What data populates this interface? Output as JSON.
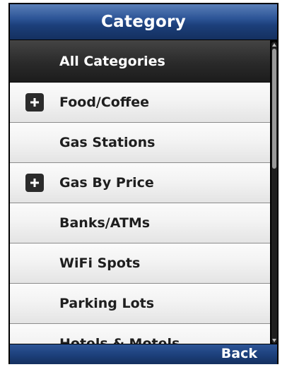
{
  "header": {
    "title": "Category"
  },
  "list": {
    "items": [
      {
        "label": "All Categories",
        "selected": true,
        "expandable": false
      },
      {
        "label": "Food/Coffee",
        "selected": false,
        "expandable": true
      },
      {
        "label": "Gas Stations",
        "selected": false,
        "expandable": false
      },
      {
        "label": "Gas By Price",
        "selected": false,
        "expandable": true
      },
      {
        "label": "Banks/ATMs",
        "selected": false,
        "expandable": false
      },
      {
        "label": "WiFi Spots",
        "selected": false,
        "expandable": false
      },
      {
        "label": "Parking Lots",
        "selected": false,
        "expandable": false
      },
      {
        "label": "Hotels & Motels",
        "selected": false,
        "expandable": false
      }
    ]
  },
  "footer": {
    "back_label": "Back"
  },
  "colors": {
    "header_blue": "#2d5597",
    "selected_row": "#2a2a2a",
    "row_bg": "#f1f1f1"
  }
}
